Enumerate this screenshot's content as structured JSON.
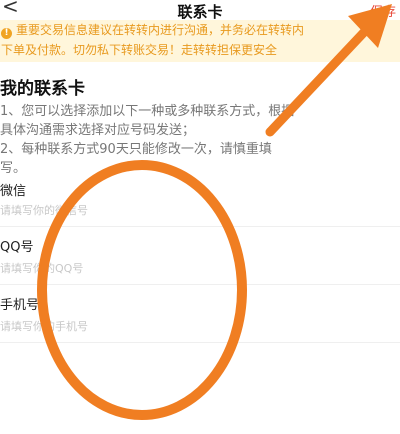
{
  "nav": {
    "back_glyph": "<",
    "title": "联系卡",
    "save_label": "保存"
  },
  "notice": {
    "icon_glyph": "!",
    "line1": "重要交易信息建议在转转内进行沟通，并务必在转转内",
    "line2": "下单及付款。切勿私下转账交易！走转转担保更安全"
  },
  "card": {
    "title": "我的联系卡",
    "tips": [
      "1、您可以选择添加以下一种或多种联系方式，根据",
      "具体沟通需求选择对应号码发送；",
      "2、每种联系方式90天只能修改一次，请慎重填",
      "写。"
    ]
  },
  "fields": {
    "wechat": {
      "label": "微信",
      "placeholder": "请填写你的微信号",
      "value": ""
    },
    "qq": {
      "label": "QQ号",
      "placeholder": "请填写你的QQ号",
      "value": ""
    },
    "phone": {
      "label": "手机号",
      "placeholder": "请填写你的手机号",
      "value": ""
    }
  },
  "colors": {
    "accent": "#e84a3b",
    "notice_bg": "#fff6db",
    "notice_text": "#e89a1f",
    "annotation": "#f07e22"
  }
}
